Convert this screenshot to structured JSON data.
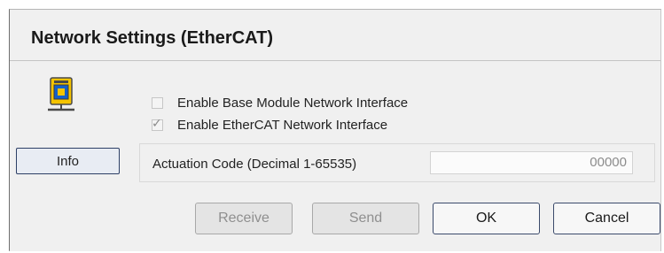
{
  "dialog": {
    "title": "Network Settings  (EtherCAT)"
  },
  "checkboxes": [
    {
      "label": "Enable Base Module Network Interface",
      "checked": false,
      "enabled": false
    },
    {
      "label": "Enable EtherCAT Network Interface",
      "checked": true,
      "enabled": false
    }
  ],
  "info_button": {
    "label": "Info"
  },
  "actuation": {
    "label": "Actuation Code (Decimal 1-65535)",
    "value": "00000"
  },
  "buttons": {
    "receive": "Receive",
    "send": "Send",
    "ok": "OK",
    "cancel": "Cancel"
  },
  "icon": "network-device-icon",
  "colors": {
    "icon_yellow": "#f5c400",
    "icon_blue": "#1560c9",
    "button_border": "#3b4a6b"
  }
}
